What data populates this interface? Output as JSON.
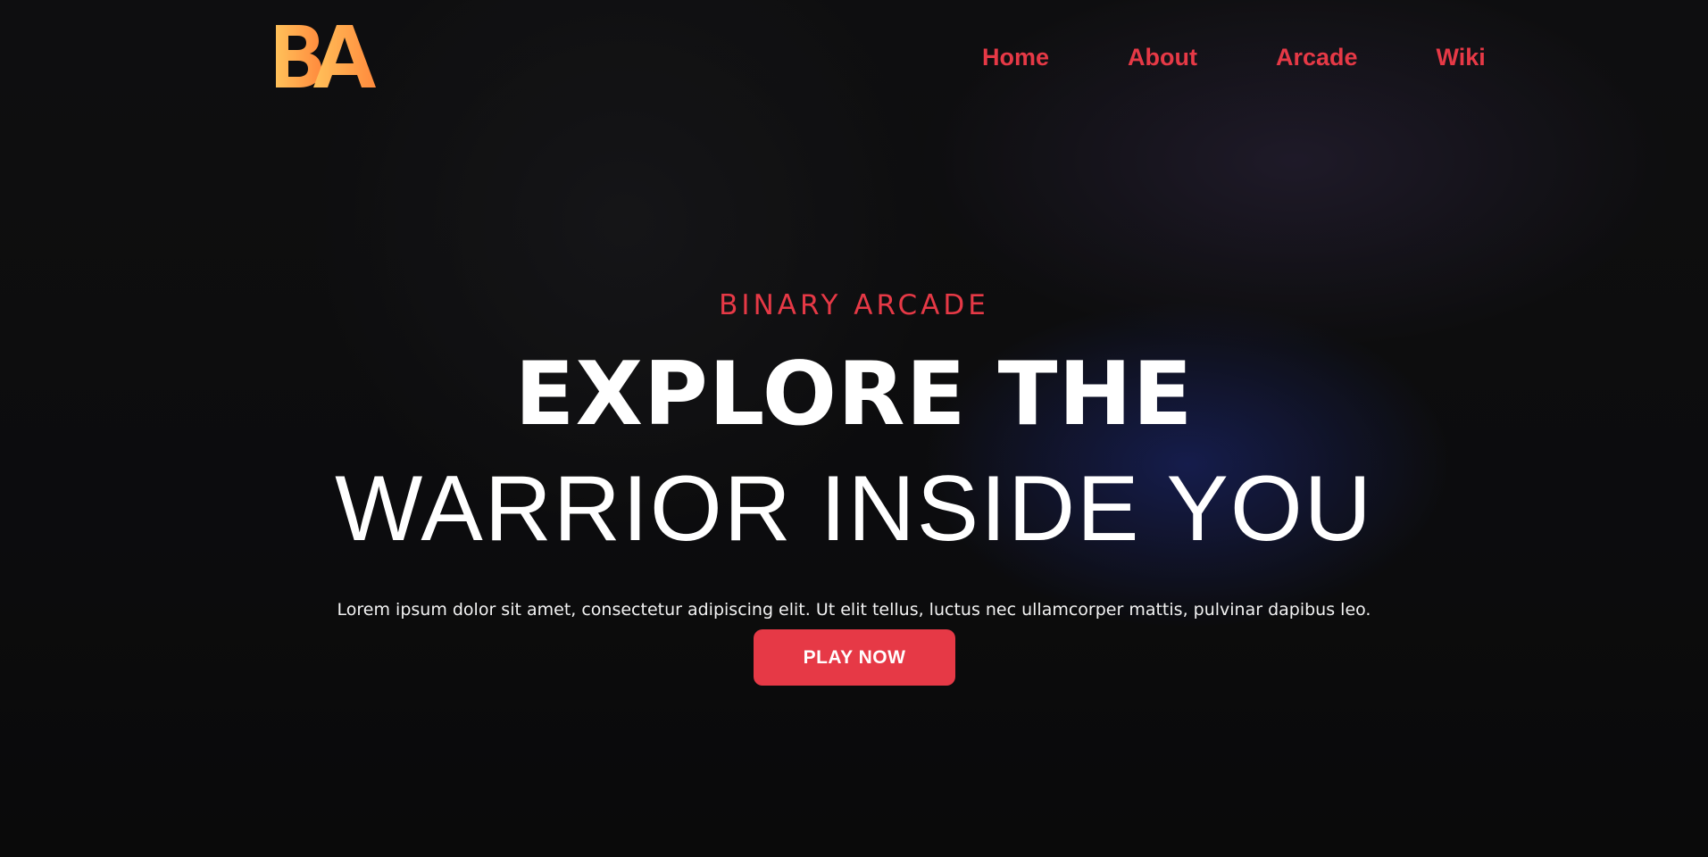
{
  "brand": {
    "logo_text": "BA",
    "logo_gradient": [
      "#ffb347",
      "#ff8a3d"
    ]
  },
  "nav": {
    "items": [
      {
        "label": "Home"
      },
      {
        "label": "About"
      },
      {
        "label": "Arcade"
      },
      {
        "label": "Wiki"
      }
    ],
    "color": "#e63946"
  },
  "hero": {
    "eyebrow": "BINARY ARCADE",
    "headline_line1": "EXPLORE THE",
    "headline_line2": "WARRIOR INSIDE YOU",
    "lead": "Lorem ipsum dolor sit amet, consectetur adipiscing elit. Ut elit tellus, luctus nec ullamcorper mattis, pulvinar dapibus leo.",
    "cta_label": "PLAY NOW",
    "accent": "#e63946"
  }
}
